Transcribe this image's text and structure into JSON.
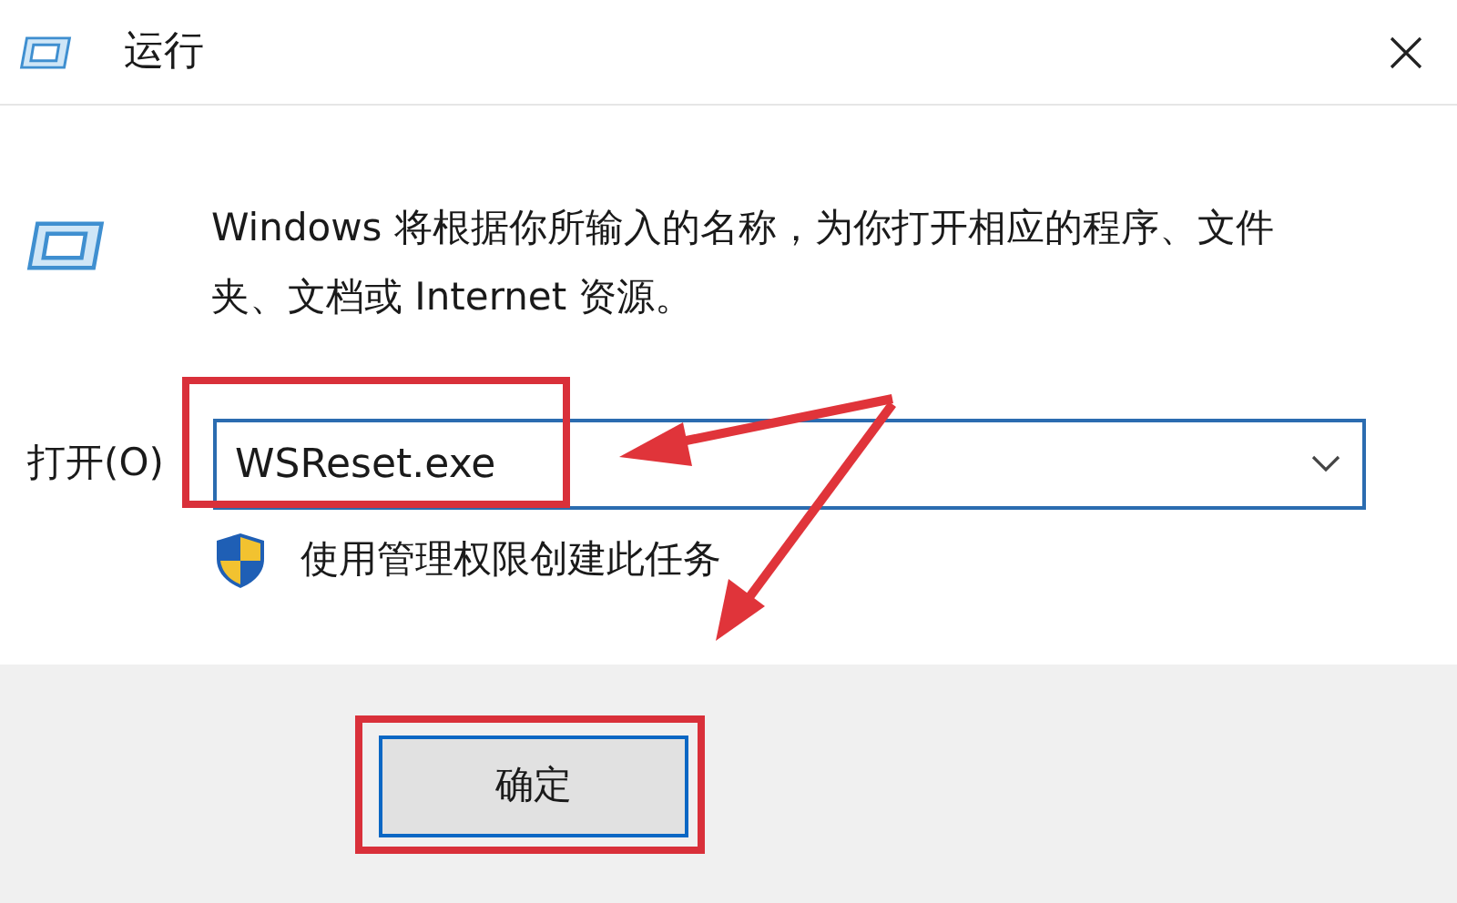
{
  "window": {
    "title": "运行"
  },
  "description": "Windows 将根据你所输入的名称，为你打开相应的程序、文件夹、文档或 Internet 资源。",
  "open_field": {
    "label": "打开(O)",
    "value": "WSReset.exe"
  },
  "admin_note": "使用管理权限创建此任务",
  "buttons": [
    {
      "label": "确定",
      "focused": true
    }
  ]
}
